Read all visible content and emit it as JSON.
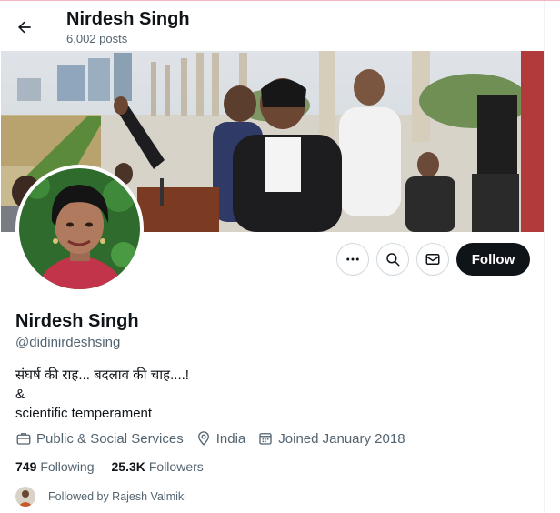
{
  "header": {
    "title": "Nirdesh Singh",
    "posts_count": "6,002 posts"
  },
  "profile": {
    "name": "Nirdesh Singh",
    "handle": "@didinirdeshsing",
    "bio": [
      "संघर्ष की राह... बदलाव की चाह....!",
      "&",
      "scientific temperament"
    ],
    "category": "Public & Social Services",
    "location": "India",
    "joined": "Joined January 2018",
    "following_count": "749",
    "following_label": "Following",
    "followers_count": "25.3K",
    "followers_label": "Followers",
    "followed_by": "Followed by Rajesh Valmiki"
  },
  "actions": {
    "more_icon": "more-icon",
    "search_icon": "search-icon",
    "message_icon": "envelope-icon",
    "follow_label": "Follow"
  },
  "colors": {
    "primary_text": "#0f1419",
    "secondary_text": "#536471",
    "follow_bg": "#0f1419",
    "border": "#cfd9de"
  }
}
